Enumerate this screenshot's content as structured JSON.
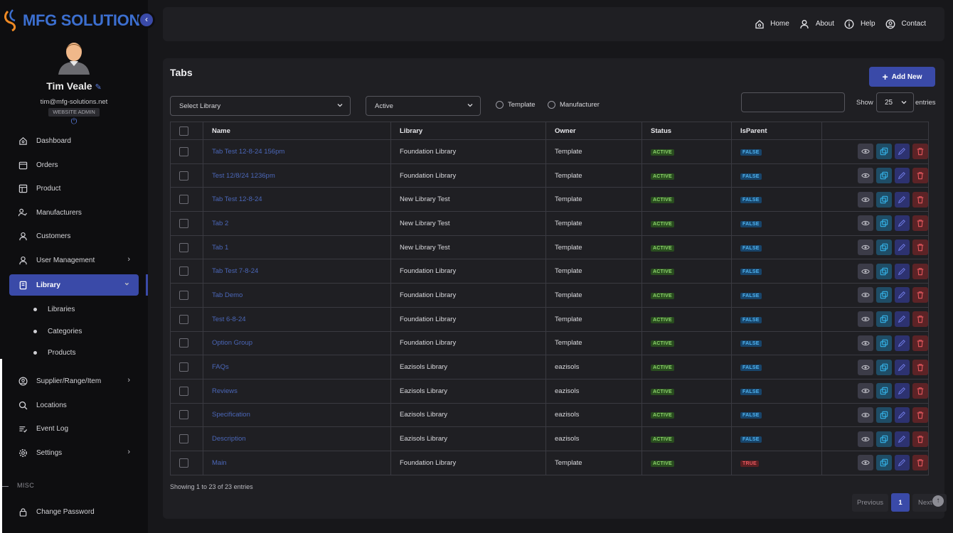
{
  "brand": {
    "name": "MFG SOLUTION",
    "collapse_icon": "chevron-left-icon"
  },
  "user": {
    "name": "Tim Veale",
    "email": "tim@mfg-solutions.net",
    "role": "WEBSITE ADMIN"
  },
  "sidebar": {
    "items": [
      {
        "label": "Dashboard",
        "icon": "home-icon"
      },
      {
        "label": "Orders",
        "icon": "calendar-icon"
      },
      {
        "label": "Product",
        "icon": "layout-icon"
      },
      {
        "label": "Manufacturers",
        "icon": "user-check-icon"
      },
      {
        "label": "Customers",
        "icon": "user-icon"
      },
      {
        "label": "User Management",
        "icon": "user-icon",
        "chevron": "›"
      },
      {
        "label": "Library",
        "icon": "book-icon",
        "chevron": "⌄",
        "active": true
      },
      {
        "label": "Supplier/Range/Item",
        "icon": "user-circle-icon",
        "chevron": "›"
      },
      {
        "label": "Locations",
        "icon": "search-icon"
      },
      {
        "label": "Event Log",
        "icon": "list-icon"
      },
      {
        "label": "Settings",
        "icon": "gear-icon",
        "chevron": "›"
      }
    ],
    "library_sub": [
      "Libraries",
      "Categories",
      "Products"
    ],
    "misc_label": "MISC",
    "misc_items": [
      {
        "label": "Change Password",
        "icon": "lock-icon"
      }
    ]
  },
  "topnav": [
    {
      "label": "Home",
      "icon": "home-icon"
    },
    {
      "label": "About",
      "icon": "user-icon"
    },
    {
      "label": "Help",
      "icon": "info-icon"
    },
    {
      "label": "Contact",
      "icon": "user-circle-icon"
    }
  ],
  "page": {
    "title": "Tabs",
    "add_button": "Add New",
    "library_select": "Select Library",
    "status_select": "Active",
    "radio_template": "Template",
    "radio_manufacturer": "Manufacturer",
    "search_value": "",
    "show_label": "Show",
    "show_value": "25",
    "entries_label": "entries"
  },
  "table": {
    "headers": [
      "Name",
      "Library",
      "Owner",
      "Status",
      "IsParent"
    ],
    "rows": [
      {
        "name": "Tab Test 12-8-24 156pm",
        "library": "Foundation Library",
        "owner": "Template",
        "status": "ACTIVE",
        "is_parent": "FALSE"
      },
      {
        "name": "Test 12/8/24 1236pm",
        "library": "Foundation Library",
        "owner": "Template",
        "status": "ACTIVE",
        "is_parent": "FALSE"
      },
      {
        "name": "Tab Test 12-8-24",
        "library": "New Library Test",
        "owner": "Template",
        "status": "ACTIVE",
        "is_parent": "FALSE"
      },
      {
        "name": "Tab 2",
        "library": "New Library Test",
        "owner": "Template",
        "status": "ACTIVE",
        "is_parent": "FALSE"
      },
      {
        "name": "Tab 1",
        "library": "New Library Test",
        "owner": "Template",
        "status": "ACTIVE",
        "is_parent": "FALSE"
      },
      {
        "name": "Tab Test 7-8-24",
        "library": "Foundation Library",
        "owner": "Template",
        "status": "ACTIVE",
        "is_parent": "FALSE"
      },
      {
        "name": "Tab Demo",
        "library": "Foundation Library",
        "owner": "Template",
        "status": "ACTIVE",
        "is_parent": "FALSE"
      },
      {
        "name": "Test 6-8-24",
        "library": "Foundation Library",
        "owner": "Template",
        "status": "ACTIVE",
        "is_parent": "FALSE"
      },
      {
        "name": "Option Group",
        "library": "Foundation Library",
        "owner": "Template",
        "status": "ACTIVE",
        "is_parent": "FALSE"
      },
      {
        "name": "FAQs",
        "library": "Eazisols Library",
        "owner": "eazisols",
        "status": "ACTIVE",
        "is_parent": "FALSE"
      },
      {
        "name": "Reviews",
        "library": "Eazisols Library",
        "owner": "eazisols",
        "status": "ACTIVE",
        "is_parent": "FALSE"
      },
      {
        "name": "Specification",
        "library": "Eazisols Library",
        "owner": "eazisols",
        "status": "ACTIVE",
        "is_parent": "FALSE"
      },
      {
        "name": "Description",
        "library": "Eazisols Library",
        "owner": "eazisols",
        "status": "ACTIVE",
        "is_parent": "FALSE"
      },
      {
        "name": "Main",
        "library": "Foundation Library",
        "owner": "Template",
        "status": "ACTIVE",
        "is_parent": "TRUE"
      }
    ]
  },
  "footer": {
    "showing": "Showing 1 to 23 of 23 entries",
    "prev": "Previous",
    "page": "1",
    "next": "Next"
  },
  "colors": {
    "accent": "#3a4aa8",
    "link": "#4b67b8",
    "active_badge": "#8bd36a",
    "false_badge": "#4fb3f0",
    "true_badge": "#e5585e"
  }
}
